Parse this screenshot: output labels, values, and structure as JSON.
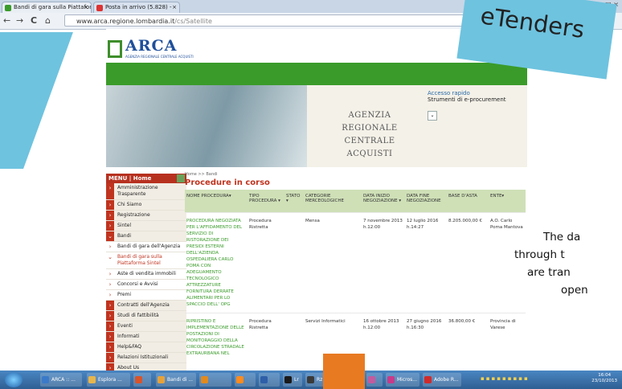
{
  "browser": {
    "tabs": [
      {
        "label": "Bandi di gara sulla Piattafor",
        "active": true
      },
      {
        "label": "Posta in arrivo (5.828) - ",
        "active": false
      }
    ],
    "url_host": "www.arca.regione.lombardia.it",
    "url_path": "/cs/Satellite",
    "back": "←",
    "forward": "→",
    "reload": "C",
    "home": "⌂"
  },
  "site": {
    "logo": "ARCA",
    "logo_sub": "AGENZIA REGIONALE CENTRALE ACQUISTI",
    "agency_line1": "AGENZIA REGIONALE",
    "agency_line2": "CENTRALE ACQUISTI",
    "quick_access_title": "Accesso rapido",
    "quick_access_sub": "Strumenti di e-procurement",
    "quick_dd": "⌄",
    "menu_title": "MENU | Home",
    "menu": [
      {
        "label": "Amministrazione Trasparente",
        "style": "dark"
      },
      {
        "label": "Chi Siamo",
        "style": "dark"
      },
      {
        "label": "Registrazione",
        "style": "dark"
      },
      {
        "label": "Sintel",
        "style": "dark"
      },
      {
        "label": "Bandi",
        "style": "dark-open"
      },
      {
        "label": "Bandi di gara dell'Agenzia",
        "style": "light"
      },
      {
        "label": "Bandi di gara sulla Piattaforma Sintel",
        "style": "light-active"
      },
      {
        "label": "Aste di vendita immobili",
        "style": "light"
      },
      {
        "label": "Concorsi e Avvisi",
        "style": "light"
      },
      {
        "label": "Premi",
        "style": "light"
      },
      {
        "label": "Contratti dell'Agenzia",
        "style": "dark"
      },
      {
        "label": "Studi di fattibilità",
        "style": "dark"
      },
      {
        "label": "Eventi",
        "style": "dark"
      },
      {
        "label": "Informati",
        "style": "dark"
      },
      {
        "label": "Help&FAQ",
        "style": "dark"
      },
      {
        "label": "Relazioni Istituzionali",
        "style": "dark"
      },
      {
        "label": "About Us",
        "style": "dark"
      }
    ],
    "breadcrumb": "Home >> Bandi",
    "page_title": "Procedure in corso",
    "columns": [
      "NOME PROCEDURA▾",
      "TIPO PROCEDURA ▾",
      "STATO ▾",
      "CATEGORIE MERCEOLOGICHE",
      "DATA INIZIO NEGOZIAZIONE ▾",
      "DATA FINE NEGOZIAZIONE",
      "BASE D'ASTA",
      "ENTE▾"
    ],
    "rows": [
      {
        "name": "PROCEDURA NEGOZIATA PER L'AFFIDAMENTO DEL SERVIZIO DI RISTORAZIONE DEI PRESIDI ESTERNI DELL'AZIENDA OSPEDALIERA CARLO POMA CON ADEGUAMENTO TECNOLOGICO ATTREZZATURE FORNITURA DERRATE ALIMENTARI PER LO SPACCIO DELL' OPG",
        "tipo": "Procedura Ristretta",
        "stato": "",
        "categoria": "Mensa",
        "inizio": "7 novembre 2013 h.12:00",
        "fine": "12 luglio 2016 h.14:27",
        "base": "8.205.000,00 €",
        "ente": "A.O. Carlo Poma Mantova"
      },
      {
        "name": "RIPRISTINO E IMPLEMENTAZIONE DELLE POSTAZIONI DI MONITORAGGIO DELLA CIRCOLAZIONE STRADALE EXTRAURBANA NEL",
        "tipo": "Procedura Ristretta",
        "stato": "",
        "categoria": "Servizi Informatici",
        "inizio": "16 ottobre 2013 h.12:00",
        "fine": "27 giugno 2016 h.16:30",
        "base": "36.800,00 €",
        "ente": "Provincia di Varese"
      }
    ]
  },
  "overlay": {
    "etenders": "eTenders",
    "side_text": [
      "The da",
      "through t",
      "are  tran",
      "open"
    ]
  },
  "taskbar": {
    "items": [
      "ARCA :: ...",
      "Esplora ...",
      "",
      "Bandi di ...",
      "",
      "",
      "",
      "Lr",
      "Rz",
      "",
      "Micros...",
      "Adobe R..."
    ],
    "clock_time": "16:04",
    "clock_date": "23/10/2013"
  },
  "colors": {
    "green": "#3a9b2a",
    "menu_red": "#c0341f",
    "overlay_blue": "#6ec3df",
    "orange": "#e87a22"
  }
}
